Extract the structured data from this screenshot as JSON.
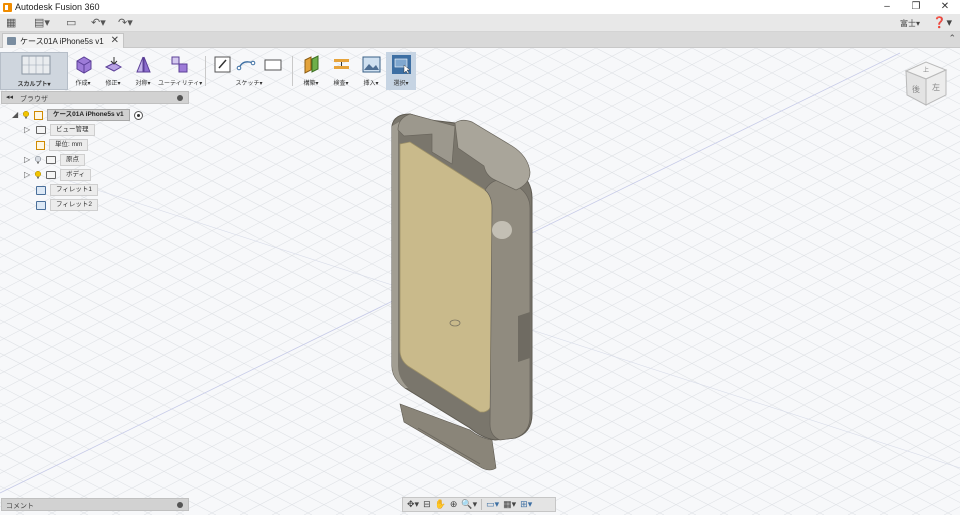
{
  "window": {
    "title": "Autodesk Fusion 360",
    "minimize": "–",
    "restore": "❐",
    "close": "✕"
  },
  "quick_access": {
    "grid": "▦",
    "file": "▤▾",
    "save": "▭",
    "undo": "↶▾",
    "redo": "↷▾",
    "account": "富士▾",
    "help": "❓▾"
  },
  "document": {
    "tab_label": "ケース01A iPhone5s v1",
    "close": "✕",
    "overflow": "⌃"
  },
  "toolbar": {
    "workspace": "スカルプト▾",
    "create": "作成▾",
    "modify": "修正▾",
    "symmetry": "対称▾",
    "utilities": "ユーティリティ▾",
    "sketch": "スケッチ▾",
    "construct": "構築▾",
    "inspect": "検査▾",
    "insert": "挿入▾",
    "select": "選択▾"
  },
  "browser": {
    "collapse": "◂◂",
    "title": "ブラウザ",
    "root": "ケース01A iPhone5s v1",
    "items": [
      {
        "label": "ビュー管理",
        "toggle": "▷"
      },
      {
        "label": "単位: mm",
        "toggle": ""
      },
      {
        "label": "原点",
        "toggle": "▷"
      },
      {
        "label": "ボディ",
        "toggle": "▷"
      },
      {
        "label": "フィレット1",
        "toggle": ""
      },
      {
        "label": "フィレット2",
        "toggle": ""
      }
    ],
    "root_toggle": "◢"
  },
  "comments": {
    "label": "コメント"
  },
  "navbar": {
    "orbit": "✥▾",
    "look": "⊟",
    "pan": "✋",
    "zoom_window": "⊕",
    "zoom": "🔍▾",
    "display": "▭▾",
    "grid": "▦▾",
    "viewports": "⊞▾"
  },
  "viewcube": {
    "top_face": "上",
    "front_face": "後",
    "side_face": "左"
  },
  "colors": {
    "case_wall": "#8f8a7e",
    "case_inner": "#c8b98a",
    "accent_select": "#3d6fa3"
  }
}
